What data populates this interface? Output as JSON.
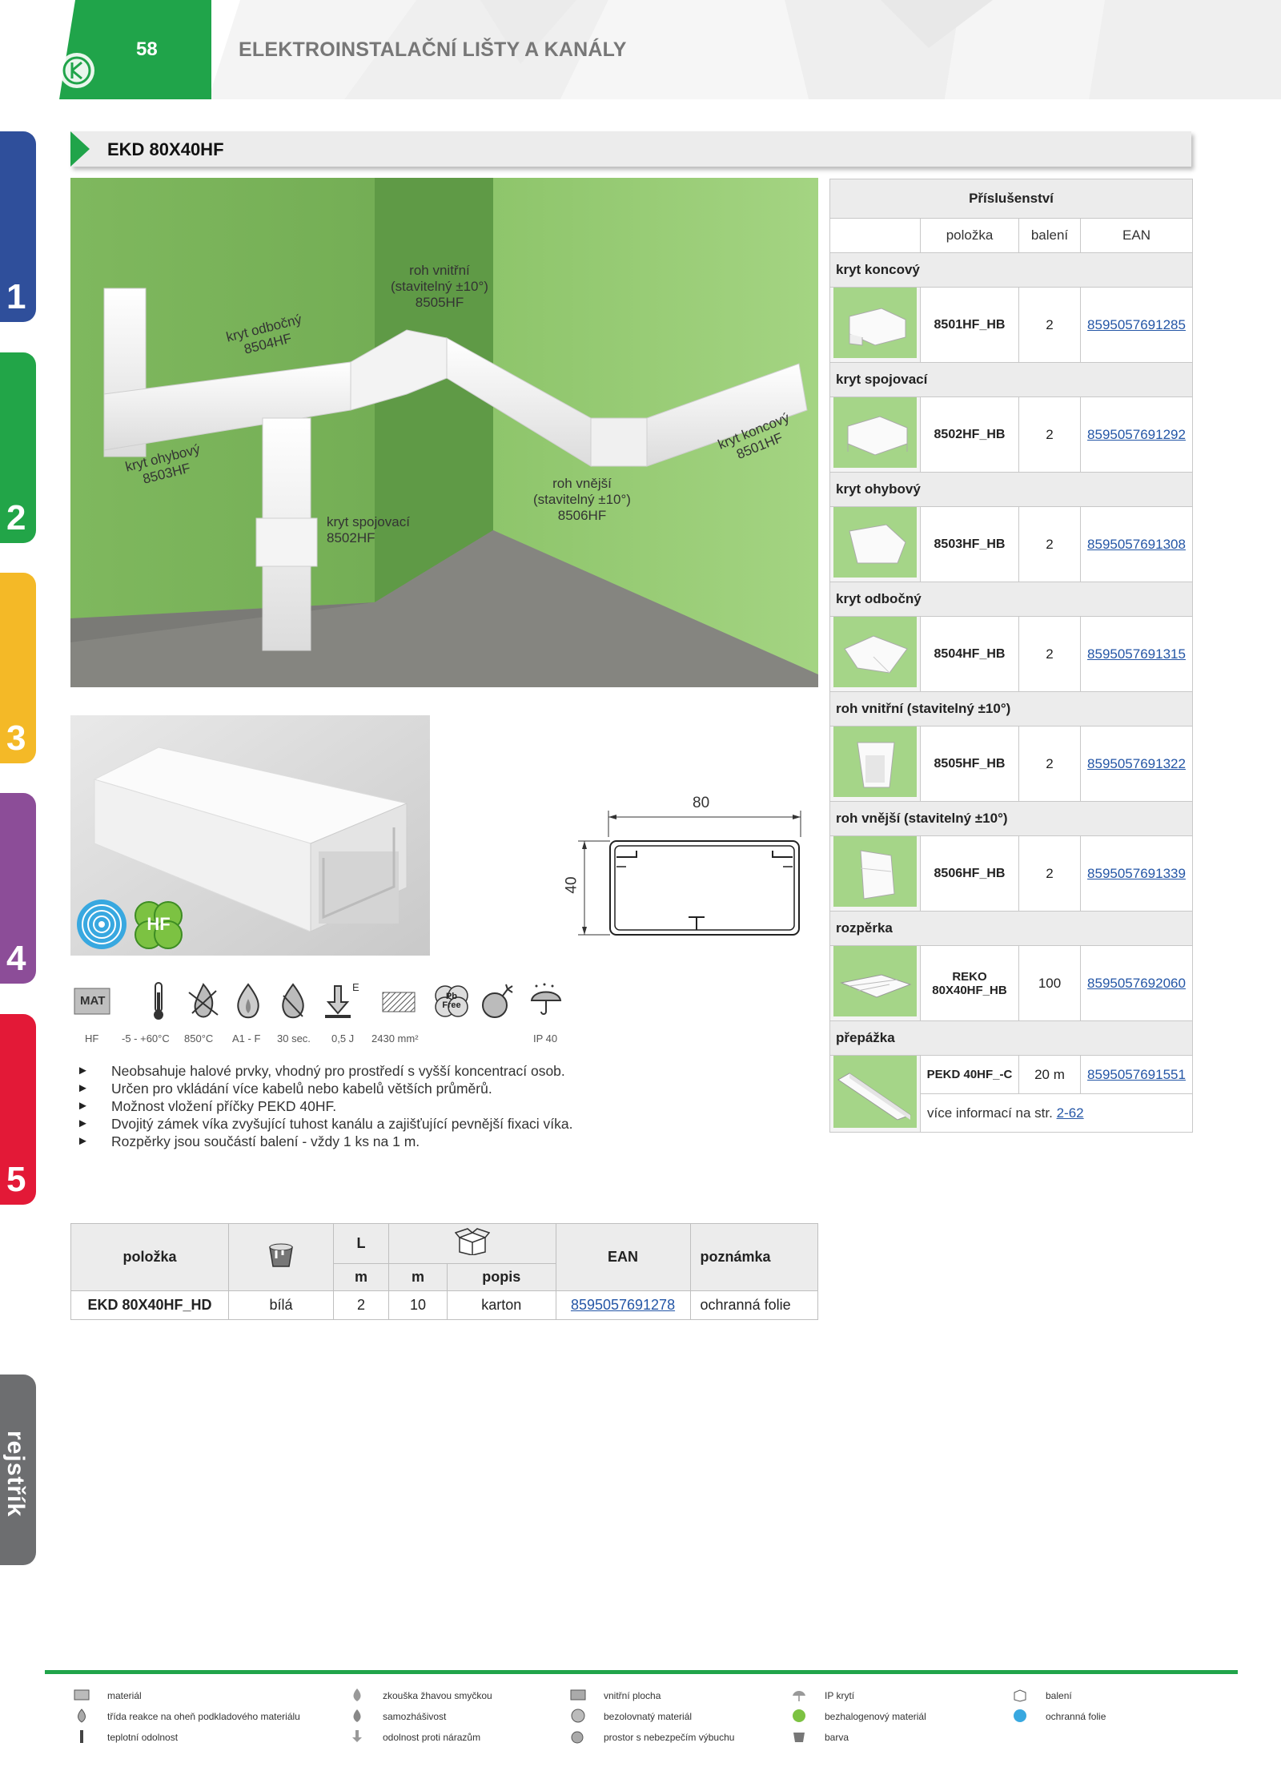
{
  "header": {
    "page_number": "58",
    "title": "ELEKTROINSTALAČNÍ LIŠTY A KANÁLY"
  },
  "side_tabs": [
    {
      "label": "1",
      "color": "#2f4f9b"
    },
    {
      "label": "2",
      "color": "#22a548"
    },
    {
      "label": "3",
      "color": "#f4b927"
    },
    {
      "label": "4",
      "color": "#8c4d98"
    },
    {
      "label": "5",
      "color": "#e31937"
    },
    {
      "label": "rejstřík",
      "color": "#6d6e70"
    }
  ],
  "section": {
    "title": "EKD 80X40HF",
    "accent_color": "#20a44a"
  },
  "scene_labels": {
    "roh_vnitrni": [
      "roh vnitřní",
      "(stavitelný ±10°)",
      "8505HF"
    ],
    "kryt_odbocny": [
      "kryt odbočný",
      "8504HF"
    ],
    "kryt_ohybovy": [
      "kryt ohybový",
      "8503HF"
    ],
    "kryt_spojovaci": [
      "kryt spojovací",
      "8502HF"
    ],
    "roh_vnejsi": [
      "roh vnější",
      "(stavitelný ±10°)",
      "8506HF"
    ],
    "kryt_koncovy": [
      "kryt koncový",
      "8501HF"
    ]
  },
  "badges": {
    "hf": "HF"
  },
  "dimensions": {
    "width": "80",
    "height": "40"
  },
  "properties": [
    {
      "icon": "material-icon",
      "badge": "MAT",
      "label": "HF"
    },
    {
      "icon": "thermometer-icon",
      "label": "-5 - +60°C"
    },
    {
      "icon": "glow-wire-icon",
      "label": "850°C"
    },
    {
      "icon": "flame-drop-icon",
      "label": "A1 - F"
    },
    {
      "icon": "self-extinguish-icon",
      "label": "30 sec."
    },
    {
      "icon": "impact-icon",
      "badge": "E",
      "label": "0,5 J"
    },
    {
      "icon": "inner-area-icon",
      "label": "2430 mm²"
    },
    {
      "icon": "pb-free-icon",
      "badge": "Pb Free",
      "label": ""
    },
    {
      "icon": "explosion-icon",
      "label": ""
    },
    {
      "icon": "ip-icon",
      "label": "IP 40"
    }
  ],
  "bullets": [
    "Neobsahuje halové prvky, vhodný pro prostředí s vyšší koncentrací osob.",
    "Určen pro vkládání více kabelů nebo kabelů větších průměrů.",
    "Možnost vložení příčky PEKD 40HF.",
    "Dvojitý zámek víka zvyšující tuhost kanálu a zajišťující pevnější fixaci víka.",
    "Rozpěrky jsou součástí balení - vždy 1 ks na 1 m."
  ],
  "main_table": {
    "headers": {
      "polozka": "položka",
      "L": "L",
      "m1": "m",
      "m2": "m",
      "popis": "popis",
      "ean": "EAN",
      "poznamka": "poznámka"
    },
    "row": {
      "polozka": "EKD 80X40HF_HD",
      "barva": "bílá",
      "L": "2",
      "baleni": "10",
      "popis": "karton",
      "ean": "8595057691278",
      "poznamka": "ochranná folie"
    }
  },
  "accessories": {
    "title": "Příslušenství",
    "col_polozka": "položka",
    "col_baleni": "balení",
    "col_ean": "EAN",
    "groups": [
      {
        "name": "kryt koncový",
        "code": "8501HF_HB",
        "qty": "2",
        "ean": "8595057691285"
      },
      {
        "name": "kryt spojovací",
        "code": "8502HF_HB",
        "qty": "2",
        "ean": "8595057691292"
      },
      {
        "name": "kryt ohybový",
        "code": "8503HF_HB",
        "qty": "2",
        "ean": "8595057691308"
      },
      {
        "name": "kryt odbočný",
        "code": "8504HF_HB",
        "qty": "2",
        "ean": "8595057691315"
      },
      {
        "name": "roh vnitřní (stavitelný ±10°)",
        "code": "8505HF_HB",
        "qty": "2",
        "ean": "8595057691322"
      },
      {
        "name": "roh vnější (stavitelný ±10°)",
        "code": "8506HF_HB",
        "qty": "2",
        "ean": "8595057691339"
      },
      {
        "name": "rozpěrka",
        "code": "REKO 80X40HF_HB",
        "qty": "100",
        "ean": "8595057692060"
      }
    ],
    "last": {
      "name": "přepážka",
      "code": "PEKD 40HF_-C",
      "qty": "20 m",
      "ean": "8595057691551",
      "more_text": "více informací na str.",
      "more_link": "2-62"
    }
  },
  "legend": [
    [
      "materiál",
      "třída reakce na oheň podkladového materiálu",
      "teplotní odolnost"
    ],
    [
      "zkouška žhavou smyčkou",
      "samozhášivost",
      "odolnost proti nárazům"
    ],
    [
      "vnitřní plocha",
      "bezolovnatý materiál",
      "prostor s nebezpečím výbuchu"
    ],
    [
      "IP krytí",
      "bezhalogenový materiál",
      "barva"
    ],
    [
      "balení",
      "ochranná folie"
    ]
  ]
}
